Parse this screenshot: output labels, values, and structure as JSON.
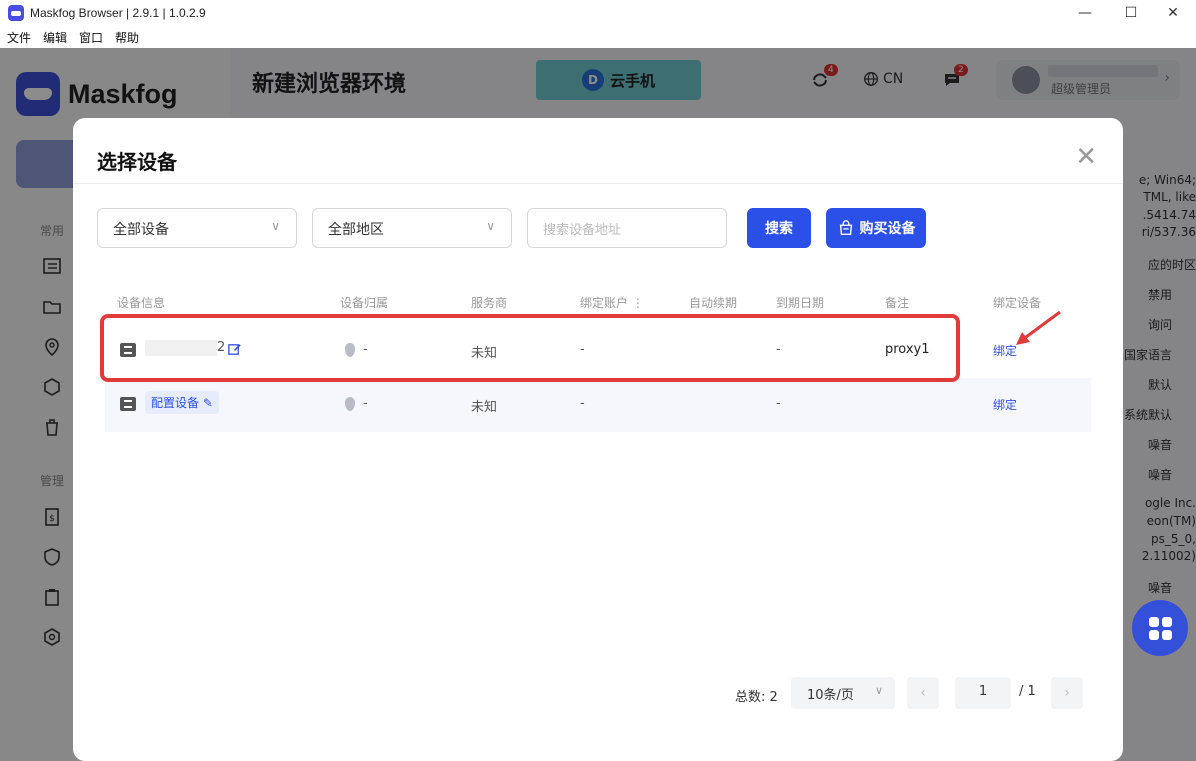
{
  "window": {
    "title": "Maskfog Browser | 2.9.1 | 1.0.2.9",
    "minimize": "—",
    "maximize": "☐",
    "close": "✕"
  },
  "menu": [
    "文件",
    "编辑",
    "窗口",
    "帮助"
  ],
  "brand": {
    "name": "Maskfog"
  },
  "sidebar": {
    "section_common": "常用",
    "section_manage": "管理"
  },
  "header": {
    "title": "新建浏览器环境",
    "banner": "云手机",
    "sync_badge": "4",
    "lang": "CN",
    "msg_badge": "2",
    "user_role": "超级管理员"
  },
  "right_panel": [
    "e; Win64;",
    "TML, like",
    ".5414.74",
    "ri/537.36",
    "应的时区",
    "禁用",
    "询问",
    "国家语言",
    "默认",
    "系统默认",
    "噪音",
    "噪音",
    "ogle Inc.",
    "eon(TM)",
    "ps_5_0,",
    "2.11002)",
    "噪音",
    "噪音",
    "噪音"
  ],
  "modal": {
    "title": "选择设备",
    "close": "✕",
    "filter_device": "全部设备",
    "filter_region": "全部地区",
    "search_placeholder": "搜索设备地址",
    "search_button": "搜索",
    "buy_button": "购买设备",
    "columns": [
      "设备信息",
      "设备归属",
      "服务商",
      "绑定账户 ⋮",
      "自动续期",
      "到期日期",
      "备注",
      "绑定设备"
    ],
    "rows": [
      {
        "name_suffix": "2",
        "location": "-",
        "provider": "未知",
        "account": "-",
        "expire": "-",
        "note": "proxy1",
        "action": "绑定"
      },
      {
        "config_label": "配置设备",
        "location": "-",
        "provider": "未知",
        "account": "-",
        "expire": "-",
        "note": "",
        "action": "绑定"
      }
    ],
    "pagination": {
      "total": "总数: 2",
      "page_size": "10条/页",
      "current": "1",
      "of": "/ 1"
    }
  }
}
